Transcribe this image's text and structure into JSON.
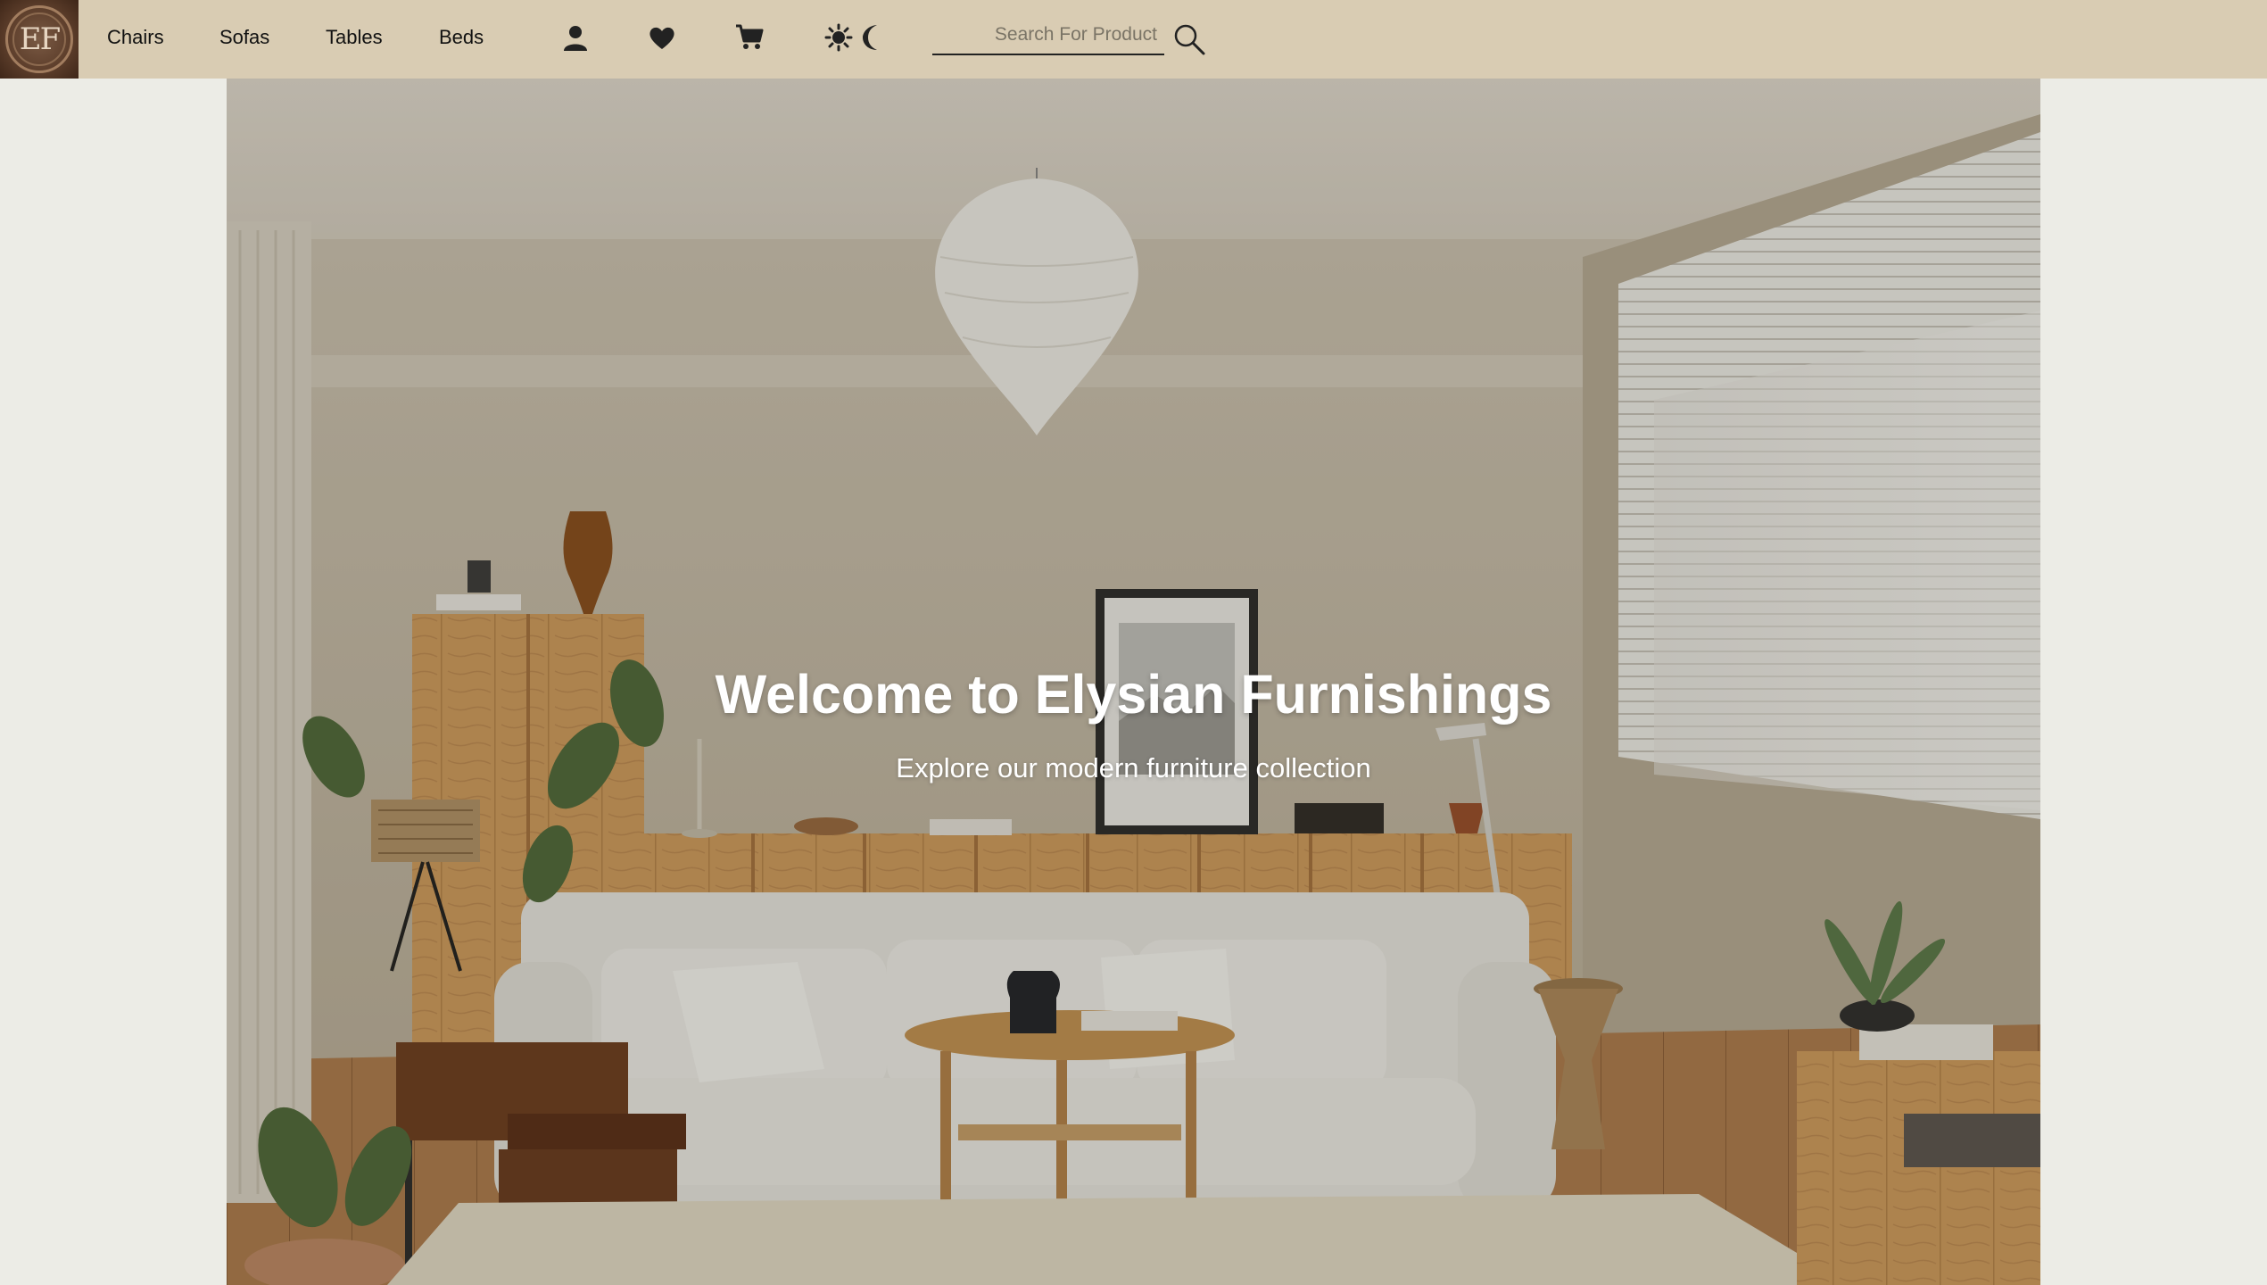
{
  "brand": {
    "logo_text": "EF"
  },
  "nav": {
    "links": [
      {
        "label": "Chairs"
      },
      {
        "label": "Sofas"
      },
      {
        "label": "Tables"
      },
      {
        "label": "Beds"
      }
    ]
  },
  "icons": {
    "account": "user-icon",
    "wishlist": "heart-icon",
    "cart": "cart-icon",
    "light_mode": "sun-icon",
    "dark_mode": "moon-icon",
    "search": "search-icon"
  },
  "search": {
    "placeholder": "Search For Product",
    "value": ""
  },
  "hero": {
    "title": "Welcome to Elysian Furnishings",
    "subtitle": "Explore our modern furniture collection"
  },
  "colors": {
    "navbar_bg": "#d9ccb3",
    "page_bg": "#ecece6",
    "hero_text": "#ffffff"
  }
}
